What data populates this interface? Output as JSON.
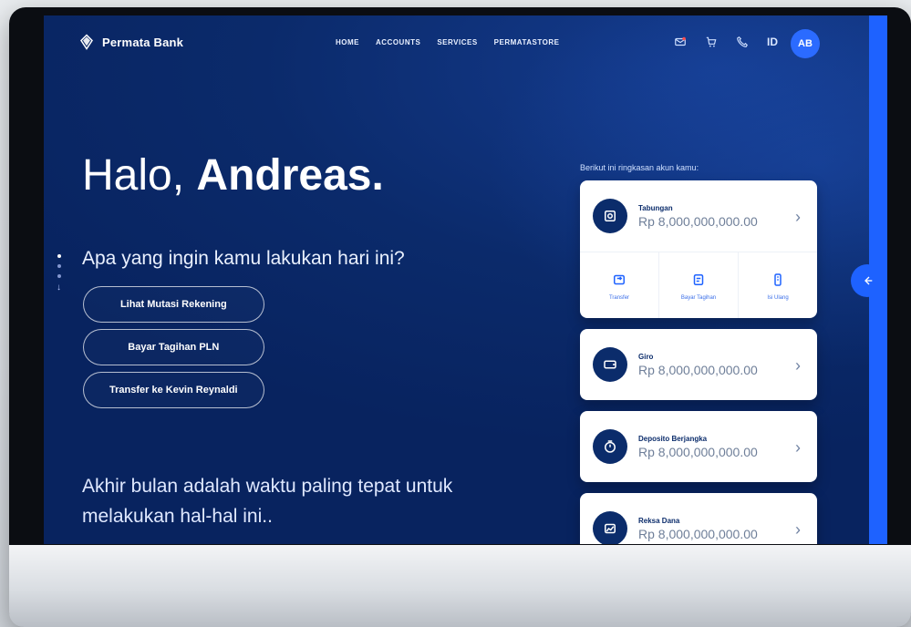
{
  "brand": {
    "name": "Permata Bank"
  },
  "nav": {
    "items": [
      "HOME",
      "ACCOUNTS",
      "SERVICES",
      "PERMATASTORE"
    ],
    "lang": "ID",
    "avatar_initials": "AB",
    "icons": [
      "mail-icon",
      "cart-icon",
      "phone-icon"
    ]
  },
  "hero": {
    "greeting_prefix": "Halo,",
    "greeting_name": "Andreas.",
    "subtitle": "Apa yang ingin kamu lakukan hari ini?"
  },
  "actions": [
    "Lihat Mutasi Rekening",
    "Bayar Tagihan PLN",
    "Transfer ke Kevin Reynaldi"
  ],
  "bottom_text": "Akhir bulan adalah waktu paling tepat untuk melakukan hal-hal ini..",
  "panel": {
    "title": "Berikut ini ringkasan akun kamu:",
    "accounts": [
      {
        "label": "Tabungan",
        "amount": "Rp 8,000,000,000.00",
        "icon": "safe-icon",
        "actions": [
          {
            "label": "Transfer",
            "icon": "transfer-icon"
          },
          {
            "label": "Bayar Tagihan",
            "icon": "bill-icon"
          },
          {
            "label": "Isi Ulang",
            "icon": "topup-icon"
          }
        ]
      },
      {
        "label": "Giro",
        "amount": "Rp 8,000,000,000.00",
        "icon": "wallet-icon"
      },
      {
        "label": "Deposito Berjangka",
        "amount": "Rp 8,000,000,000.00",
        "icon": "deposit-timer-icon"
      },
      {
        "label": "Reksa Dana",
        "amount": "Rp 8,000,000,000.00",
        "icon": "fund-icon"
      }
    ]
  },
  "colors": {
    "primary_blue": "#0b2c6b",
    "accent_blue": "#1e62ff"
  }
}
